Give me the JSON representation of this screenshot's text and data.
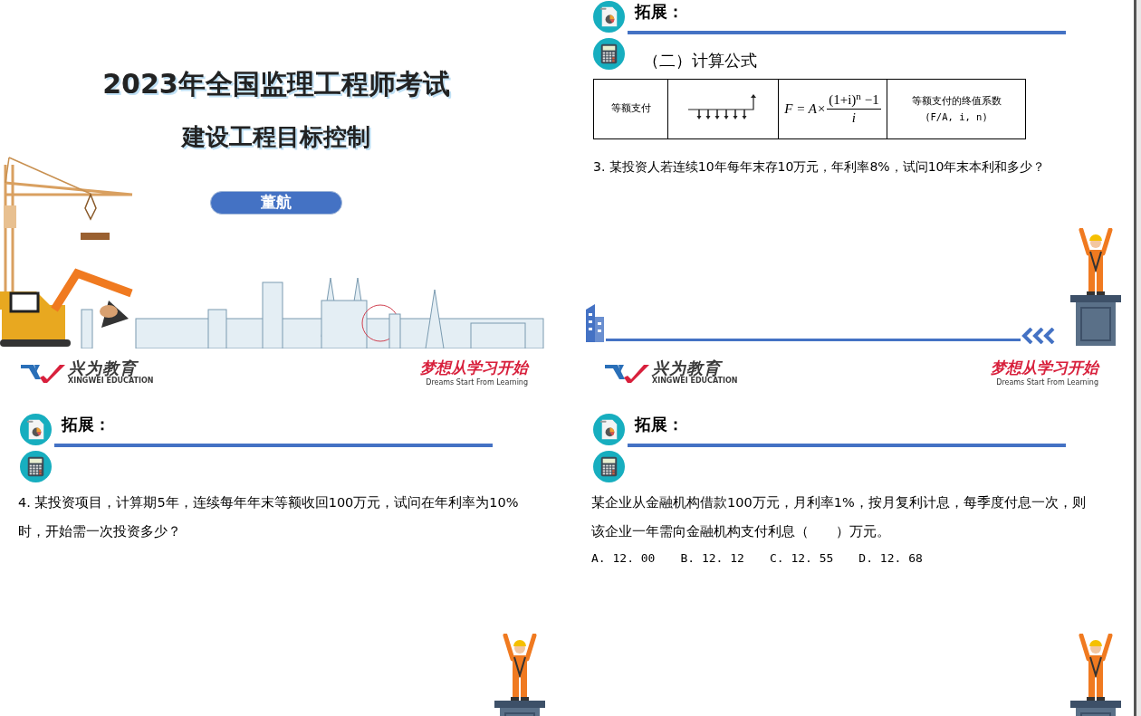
{
  "slides": [
    {
      "kind": "cover",
      "title": "2023年全国监理工程师考试",
      "subtitle": "建设工程目标控制",
      "presenter": "董航",
      "footer": {
        "brand": "兴为教育",
        "brand_en": "XINGWEI EDUCATION",
        "slogan": "梦想从学习开始",
        "slogan_en": "Dreams Start From Learning"
      }
    },
    {
      "kind": "formula",
      "heading": "拓展：",
      "section": "（二）计算公式",
      "table": {
        "name": "等额支付",
        "formula_lhs": "F = A×",
        "numerator": "(1+i)$^{n}$ −1",
        "denominator": "i",
        "factor_name": "等额支付的终值系数",
        "factor_symbol": "(F/A, i, n)"
      },
      "question": "3. 某投资人若连续10年每年末存10万元，年利率8%，试问10年末本利和多少？",
      "footer": {
        "brand": "兴为教育",
        "brand_en": "XINGWEI EDUCATION",
        "slogan": "梦想从学习开始",
        "slogan_en": "Dreams Start From Learning"
      }
    },
    {
      "kind": "question",
      "heading": "拓展：",
      "question": "4. 某投资项目，计算期5年，连续每年年末等额收回100万元，试问在年利率为10%时，开始需一次投资多少？"
    },
    {
      "kind": "question",
      "heading": "拓展：",
      "question": "某企业从金融机构借款100万元，月利率1%，按月复利计息，每季度付息一次，则该企业一年需向金融机构支付利息（　　）万元。",
      "options": [
        "A. 12. 00",
        "B. 12. 12",
        "C. 12. 55",
        "D. 12. 68"
      ]
    }
  ]
}
